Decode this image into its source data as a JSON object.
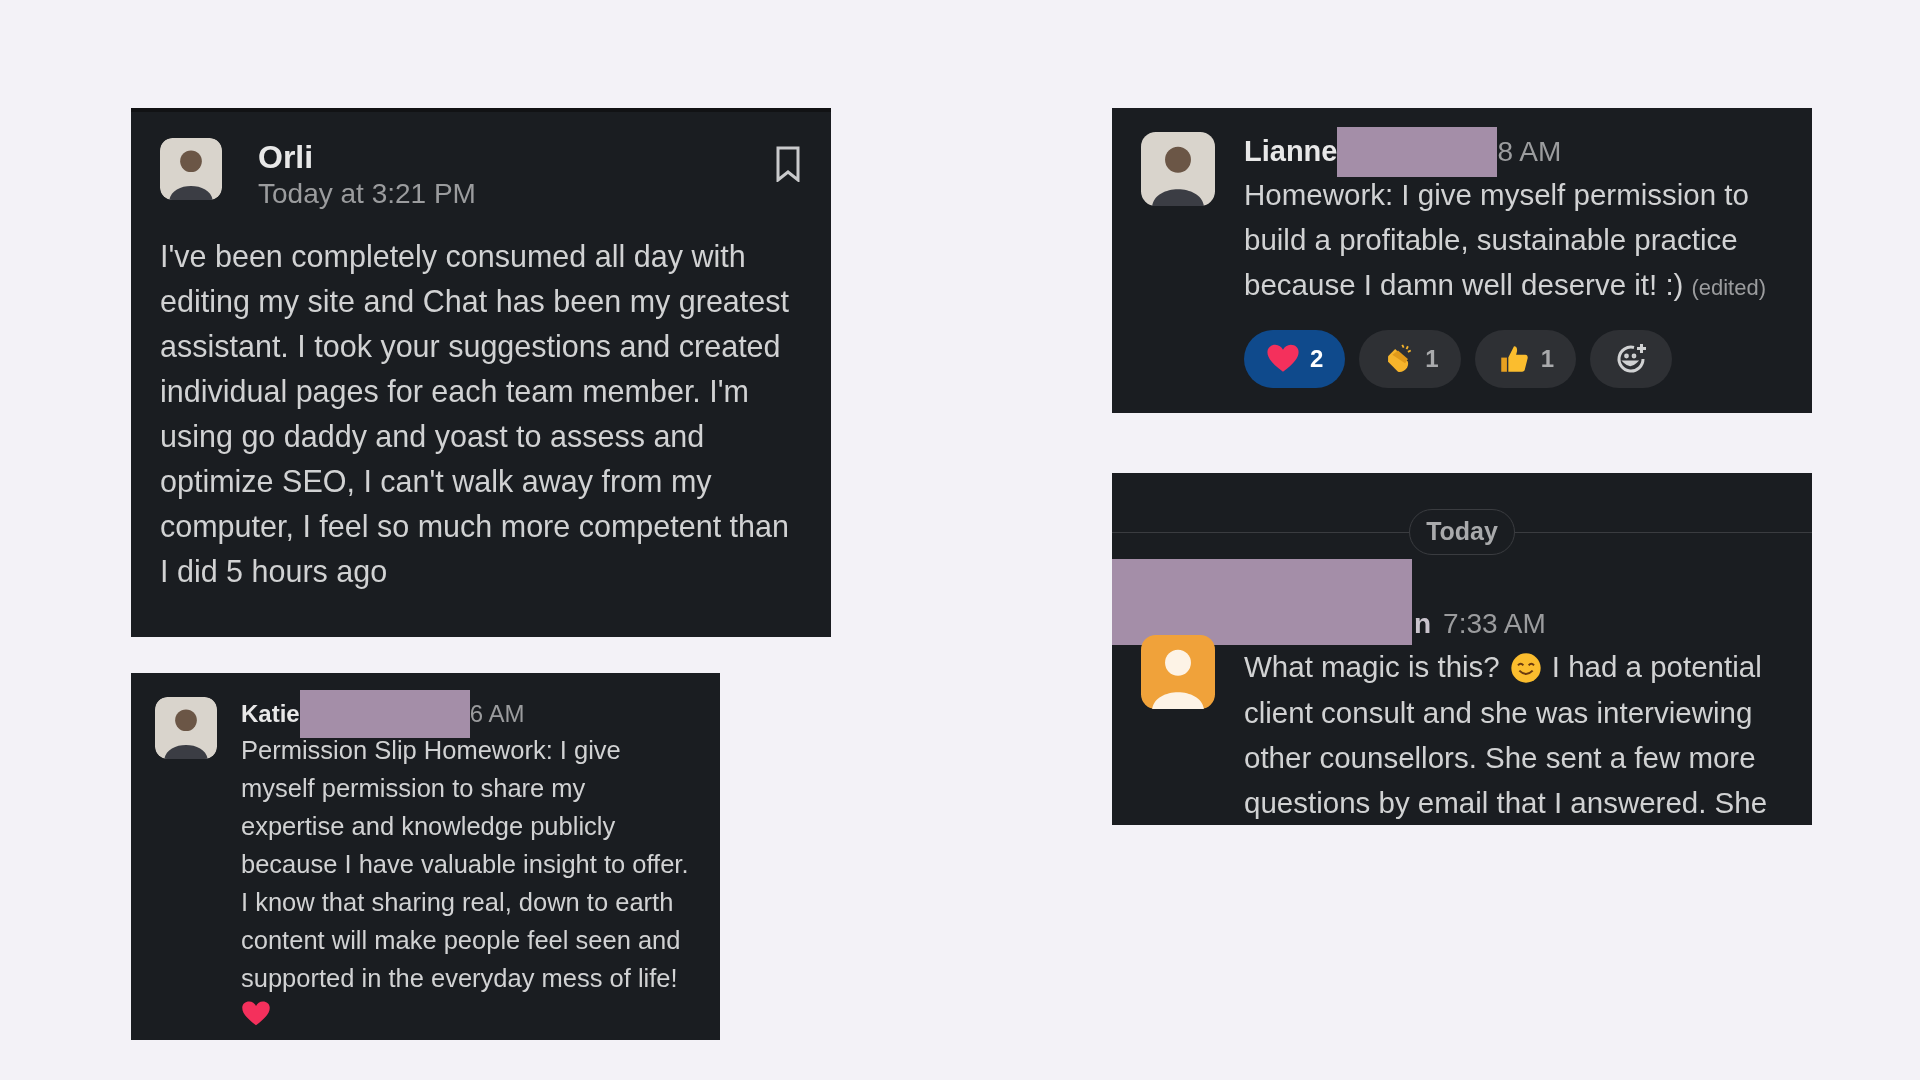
{
  "columns": [
    [
      {
        "kind": "post",
        "author": "Orli",
        "time": "Today at 3:21 PM",
        "bookmark": true,
        "text": "I've been completely consumed all day with\nediting my site and Chat has been my greatest\nassistant. I took your suggestions and created\nindividual pages for each team member. I'm\nusing go daddy and yoast to assess and\noptimize SEO, I can't walk away from my\ncomputer, I feel so much more competent than\nI did 5 hours ago"
      },
      {
        "kind": "compact",
        "author": "Katie",
        "time": "6 AM",
        "text": "Permission Slip Homework: I give\nmyself permission to share my\nexpertise and knowledge publicly\nbecause I have valuable insight to offer.\nI know that sharing real, down to earth\ncontent will make people feel seen and\nsupported in the everyday mess of life!"
      }
    ],
    [
      {
        "kind": "reacted",
        "author": "Lianne",
        "time": "8 AM",
        "text": "Homework: I give myself permission to\nbuild a profitable, sustainable practice\nbecause I damn well deserve it! :)",
        "edited": "(edited)",
        "reactions": [
          {
            "kind": "heart",
            "count": "2",
            "selected": true
          },
          {
            "kind": "clap",
            "count": "1",
            "selected": false
          },
          {
            "kind": "thumbs",
            "count": "1",
            "selected": false
          }
        ]
      },
      {
        "kind": "dated",
        "divider": "Today",
        "author_tail": "n",
        "time": "7:33 AM",
        "text_start": "What magic is this?",
        "text_after_emoji": "I had a potential",
        "text": "client consult and she was interviewing\nother counsellors. She sent a few more\nquestions by email that I answered. She"
      }
    ]
  ]
}
